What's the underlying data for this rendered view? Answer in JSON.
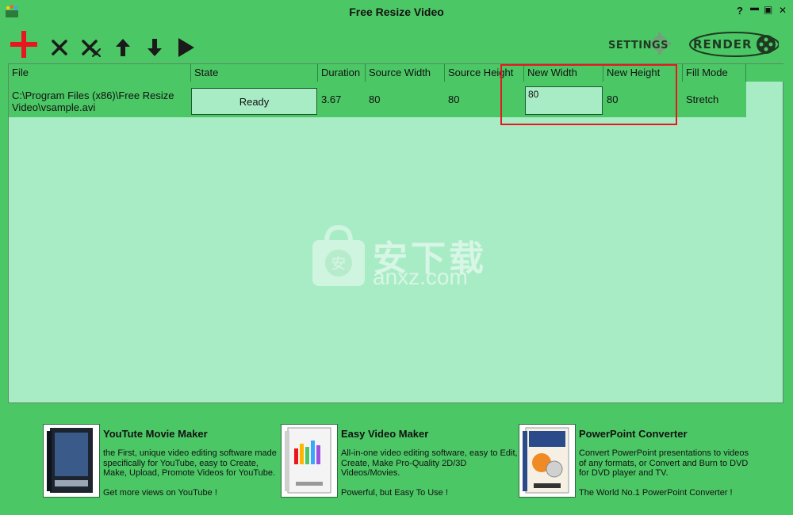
{
  "window": {
    "title": "Free Resize Video",
    "help": "?",
    "minimize": "▬",
    "maximize": "▣",
    "close": "✕"
  },
  "toolbar": {
    "settings_label": "SETTINGS",
    "render_label": "RENDER",
    "icons": [
      "add-icon",
      "remove-icon",
      "remove-all-icon",
      "move-up-icon",
      "move-down-icon",
      "play-icon"
    ]
  },
  "grid": {
    "columns": [
      "File",
      "State",
      "Duration",
      "Source Width",
      "Source Height",
      "New Width",
      "New Height",
      "Fill Mode"
    ],
    "rows": [
      {
        "file": "C:\\Program Files (x86)\\Free Resize Video\\vsample.avi",
        "state": "Ready",
        "duration": "3.67",
        "source_width": "80",
        "source_height": "80",
        "new_width": "80",
        "new_height": "80",
        "fill_mode": "Stretch"
      }
    ]
  },
  "watermark": {
    "cn": "安下载",
    "en": "anxz.com",
    "badge": "安"
  },
  "ads": [
    {
      "title": "YouTute Movie Maker",
      "desc": "the First, unique video editing software made specifically for YouTube, easy to Create, Make, Upload, Promote Videos for YouTube.",
      "tag": "Get more views on YouTube !"
    },
    {
      "title": "Easy Video Maker",
      "desc": "All-in-one video editing software, easy to Edit, Create, Make Pro-Quality 2D/3D Videos/Movies.",
      "tag": "Powerful, but Easy To Use !"
    },
    {
      "title": "PowerPoint Converter",
      "desc": "Convert PowerPoint presentations to videos of any formats, or Convert and Burn to DVD for DVD player and TV.",
      "tag": "The World No.1 PowerPoint Converter !"
    }
  ],
  "colors": {
    "window_bg": "#4cc766",
    "grid_bg": "#a8ecc6",
    "highlight": "#e8161e",
    "add_icon": "#e8161e"
  }
}
